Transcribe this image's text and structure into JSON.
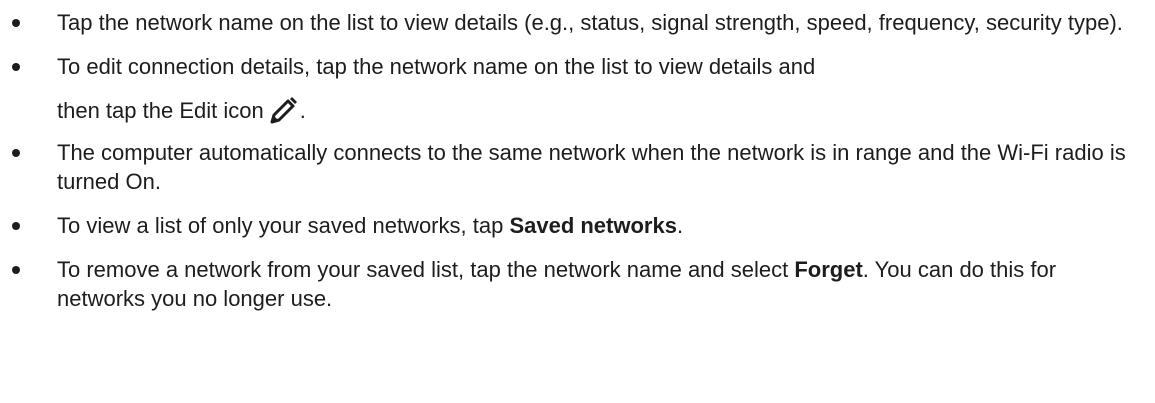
{
  "bullets": [
    {
      "text": "Tap the network name on the list to view details (e.g., status, signal strength, speed, frequency, security type)."
    },
    {
      "line1": "To edit connection details, tap the network name on the list to view details and",
      "line2_before": "then tap the Edit icon",
      "line2_after": ".",
      "icon": "pencil-edit-icon"
    },
    {
      "text": "The computer automatically connects to the same network when the network is in range and the Wi-Fi radio is turned On."
    },
    {
      "before": "To view a list of only your saved networks, tap ",
      "bold": "Saved networks",
      "after": "."
    },
    {
      "before": "To remove a network from your saved list, tap the network name and select ",
      "bold": "Forget",
      "after": ". You can do this for networks you no longer use."
    }
  ]
}
